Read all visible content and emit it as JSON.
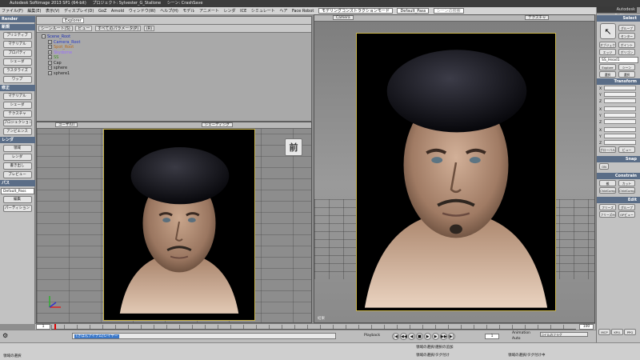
{
  "title": {
    "app": "Autodesk Softimage 2013 SP1 (64-bit)",
    "project": "プロジェクト: Sylvester_G_Stallone",
    "scene": "シーン: CrashSave",
    "brand": "Autodesk Softimage"
  },
  "menubar": {
    "items": [
      "ファイル(F)",
      "編集(E)",
      "表示(V)",
      "ディスプレイ(D)",
      "GoZ",
      "Arnold",
      "ウィンドウ(W)",
      "ヘルプ(H)",
      "モデル",
      "アニメート",
      "レンダ",
      "ICE",
      "シミュレート",
      "ヘア",
      "Face Robot"
    ],
    "mode_select": "モデリングコンストラクションモード",
    "pass_select": "Default_Pass",
    "search_placeholder": "シーンの検索"
  },
  "leftbar": {
    "render_header": "Render",
    "section1": "新規",
    "section1_items": [
      "プリミティブ",
      "マテリアル",
      "プロパティ",
      "シェーダ",
      "ラスタライズ",
      "ワップ"
    ],
    "section2": "修正",
    "section2_items": [
      "マテリアル",
      "シェーダ",
      "テクスチャ",
      "プロジェクション",
      "アンビエンス"
    ],
    "section3": "レンダ",
    "section3_items": [
      "領域",
      "レンダ",
      "書き出し",
      "プレビュー"
    ],
    "section4": "パス",
    "pass_value": "Default_Pass",
    "section4_items": [
      "編集",
      "パーティション"
    ]
  },
  "explorer": {
    "tabs": [
      "シーンルート(S)",
      "ビュー",
      "すべてのパラメータ(P)",
      "(R)"
    ],
    "dropdown": "Explorer",
    "tree": [
      {
        "label": "Scene_Root",
        "cls": "n-root"
      },
      {
        "label": "Camera_Root",
        "cls": "n-cam"
      },
      {
        "label": "Spot_Root",
        "cls": "n-light"
      },
      {
        "label": "Skydome",
        "cls": "n-sky"
      },
      {
        "label": "SS",
        "cls": "n-ss"
      },
      {
        "label": "Cap",
        "cls": "n-plain"
      },
      {
        "label": "sphere",
        "cls": "n-plain"
      },
      {
        "label": "sphere1",
        "cls": "n-plain"
      }
    ]
  },
  "viewport_left": {
    "camera": "ユーザ(U)",
    "shading": "シェーディング",
    "cube_label": "前"
  },
  "viewport_right": {
    "camera": "Camera",
    "shading": "テクスチャ",
    "footer": "結果"
  },
  "rightbar": {
    "select_header": "Select",
    "select_buttons": [
      "オブジェクト",
      "ポイント",
      "エッジ",
      "ポリゴン"
    ],
    "group_buttons": [
      "グループ",
      "センター"
    ],
    "name_field": "SS_Head1",
    "explore_buttons": [
      "Explore",
      "シーン"
    ],
    "sel_buttons": [
      "選択",
      "選択"
    ],
    "transform_header": "Transform",
    "axes": [
      "X",
      "Y",
      "Z"
    ],
    "view_buttons": [
      "グローバル",
      "ビュー"
    ],
    "snap_header": "Snap",
    "snap_on": "ON",
    "constrain_header": "Constrain",
    "constrain_buttons": [
      "親",
      "カット",
      "ChldComp",
      "ChldComp"
    ],
    "edit_header": "Edit",
    "edit_buttons": [
      "フリーズ",
      "グループ",
      "フリーズM",
      "OPビュー"
    ],
    "tabs": [
      "MCP",
      "KP/L",
      "PPG"
    ]
  },
  "timeline": {
    "start": "1",
    "end": "100",
    "end2": "100"
  },
  "playbar": {
    "playback_label": "Playback",
    "animation_label": "Animation",
    "auto_label": "Auto",
    "frame": "1",
    "layer_field": "(きほんアイテム)レイヤー",
    "field_right": "コイルのフラグ"
  },
  "status": {
    "left": "領域の選択",
    "middle": "領域の選択/選択の追加",
    "right": "領域の選択/タグ付け",
    "right2": "領域の選択/タグ付け中"
  },
  "colors": {
    "panel_header": "#5a6d87",
    "render_border": "#c9b44a"
  }
}
